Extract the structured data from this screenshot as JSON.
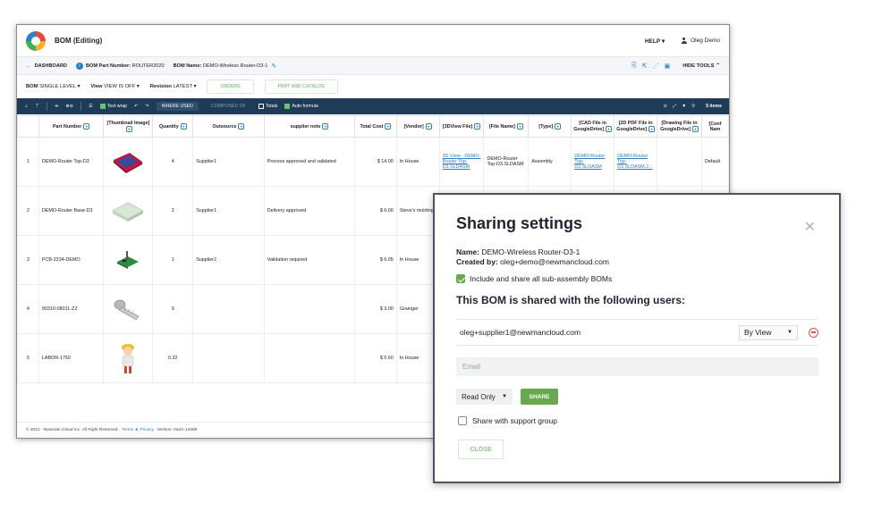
{
  "app": {
    "title": "BOM (Editing)",
    "help": "HELP ▾",
    "user": "Oleg Demo"
  },
  "crumbs": {
    "dashboard": "DASHBOARD",
    "part_number_label": "BOM Part Number:",
    "part_number": "ROUTER2020",
    "bom_name_label": "BOM Name:",
    "bom_name": "DEMO-Wireless Router-D3-1",
    "hide_tools": "HIDE TOOLS ⌃"
  },
  "viewbar": {
    "bom_label": "BOM",
    "bom_value": "SINGLE LEVEL ▾",
    "view_label": "View",
    "view_value": "VIEW IS OFF ▾",
    "revision_label": "Revision",
    "revision_value": "LATEST ▾",
    "orders": "ORDERS",
    "part_catalog": "PART AND CATALOG"
  },
  "toolbar": {
    "text_wrap": "Text wrap",
    "where_used": "WHERE USED",
    "composed_of": "COMPOSED OF",
    "totals": "Totals",
    "auto_formula": "Auto formula",
    "items": "5 items"
  },
  "table": {
    "headers": [
      "Part Number",
      "[Thumbnail Image]",
      "Quantity",
      "Outsource",
      "supplier note",
      "Total Cost",
      "[Vendor]",
      "[3DView File]",
      "[File Name]",
      "[Type]",
      "[CAD File in GoogleDrive]",
      "[2D PDF File in GoogleDrive]",
      "[Drawing File in GoogleDrive]",
      "[Conf Nam"
    ],
    "rows": [
      {
        "idx": "1",
        "part": "DEMO-Router Top-D3",
        "thumb": "router-top",
        "qty": "4",
        "outsource": "Supplier1",
        "note": "Process approved and validated",
        "cost": "$ 14.00",
        "vendor": "In House",
        "view3d": "3D View - DEMO-Router Top-D3.SLDASM",
        "file": "DEMO-Router Top-D3.SLDASM",
        "type": "Assembly",
        "cad": "DEMO-Router Top-D3.SLDASM",
        "pdf": "DEMO-Router Top-D3.SLDASM.2...",
        "drawing": "",
        "conf": "Default"
      },
      {
        "idx": "2",
        "part": "DEMO-Router Base-D3",
        "thumb": "router-base",
        "qty": "2",
        "outsource": "Supplier1",
        "note": "Delivery approved",
        "cost": "$ 6.00",
        "vendor": "Steve's molding",
        "view3d": "",
        "file": "",
        "type": "",
        "cad": "",
        "pdf": "",
        "drawing": "",
        "conf": ""
      },
      {
        "idx": "3",
        "part": "PCB-2234-DEMO",
        "thumb": "pcb",
        "qty": "1",
        "outsource": "Supplier2",
        "note": "Validation required",
        "cost": "$ 6.05",
        "vendor": "In House",
        "view3d": "",
        "file": "",
        "type": "",
        "cad": "",
        "pdf": "",
        "drawing": "",
        "conf": ""
      },
      {
        "idx": "4",
        "part": "90310-08011-ZZ",
        "thumb": "screw",
        "qty": "9",
        "outsource": "",
        "note": "",
        "cost": "$ 3.00",
        "vendor": "Grainger",
        "view3d": "",
        "file": "",
        "type": "",
        "cad": "",
        "pdf": "",
        "drawing": "",
        "conf": ""
      },
      {
        "idx": "5",
        "part": "LABOR-1750",
        "thumb": "worker",
        "qty": "0.32",
        "outsource": "",
        "note": "",
        "cost": "$ 5.60",
        "vendor": "In House",
        "view3d": "",
        "file": "",
        "type": "",
        "cad": "",
        "pdf": "",
        "drawing": "",
        "conf": ""
      }
    ]
  },
  "footer": {
    "copyright": "© 2021 - Newman Cloud Inc. All Right Reserved.",
    "terms": "Terms",
    "amp": "&",
    "privacy": "Privacy",
    "version": "Version: 0a4A-14368"
  },
  "dialog": {
    "title": "Sharing settings",
    "name_label": "Name:",
    "name_value": "DEMO-Wireless Router-D3-1",
    "created_label": "Created by:",
    "created_value": "oleg+demo@newmancloud.com",
    "include_label": "Include and share all sub-assembly BOMs",
    "shared_heading": "This BOM is shared with the following users:",
    "shared_user": "oleg+supplier1@newmancloud.com",
    "shared_permission": "By View",
    "email_placeholder": "Email",
    "access": "Read Only",
    "share_btn": "SHARE",
    "support_label": "Share with support group",
    "close_btn": "CLOSE"
  },
  "colors": {
    "toolbar_bg": "#1f3b5a",
    "accent_blue": "#2f80c3",
    "accent_green": "#6aa84f",
    "danger": "#d9534f"
  }
}
